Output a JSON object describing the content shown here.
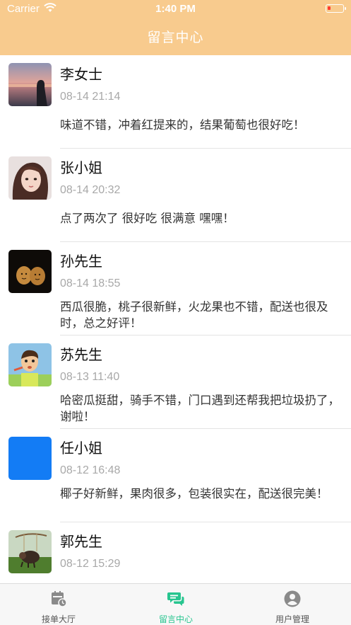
{
  "status_bar": {
    "carrier": "Carrier",
    "time": "1:40 PM",
    "icons": [
      "wifi-icon",
      "battery-low-icon"
    ]
  },
  "header": {
    "title": "留言中心",
    "background": "#f8cb8e"
  },
  "messages": [
    {
      "name": "李女士",
      "time": "08-14 21:14",
      "text": "味道不错，冲着红提来的，结果葡萄也很好吃！",
      "avatar": "sunset-silhouette-photo"
    },
    {
      "name": "张小姐",
      "time": "08-14 20:32",
      "text": "点了两次了 很好吃 很满意 嘿嘿！",
      "avatar": "girl-portrait-photo"
    },
    {
      "name": "孙先生",
      "time": "08-14 18:55",
      "text": "西瓜很脆，桃子很新鲜，火龙果也不错，配送也很及时，总之好评！",
      "avatar": "two-eggs-photo"
    },
    {
      "name": "苏先生",
      "time": "08-13 11:40",
      "text": "哈密瓜挺甜，骑手不错，门口遇到还帮我把垃圾扔了，谢啦！",
      "avatar": "cartoon-man-photo"
    },
    {
      "name": "任小姐",
      "time": "08-12 16:48",
      "text": "椰子好新鲜，果肉很多，包装很实在，配送很完美！",
      "avatar": "blue-square-avatar"
    },
    {
      "name": "郭先生",
      "time": "08-12 15:29",
      "text": "",
      "avatar": "pig-swing-photo"
    }
  ],
  "tabbar": {
    "active_color": "#27c58f",
    "tabs": [
      {
        "label": "接单大厅",
        "icon": "calendar-clock-icon",
        "active": false
      },
      {
        "label": "留言中心",
        "icon": "chat-bubbles-icon",
        "active": true
      },
      {
        "label": "用户管理",
        "icon": "user-circle-icon",
        "active": false
      }
    ]
  }
}
